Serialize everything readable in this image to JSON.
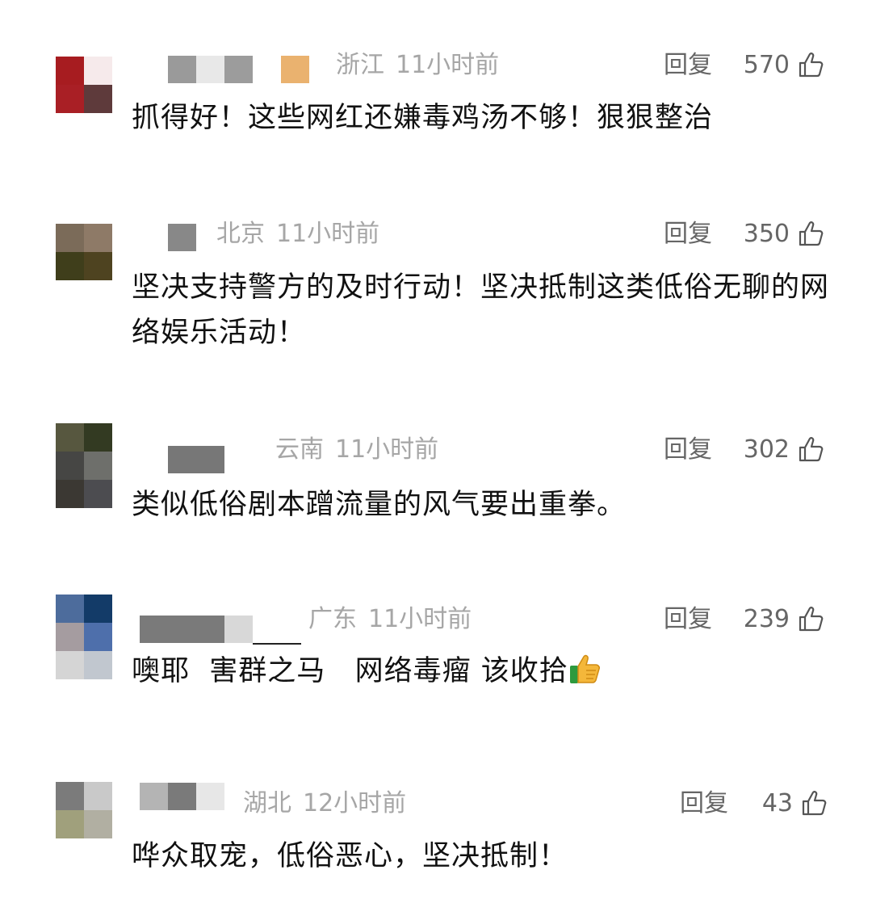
{
  "comments": [
    {
      "avatar_colors": [
        "#a71c20",
        "#f6eaeb",
        "#a91f25",
        "#5e3a3b"
      ],
      "name_blocks": [
        "#9a9a9a",
        "#e8e8e8",
        "#9c9c9c",
        "#eab26f"
      ],
      "location": "浙江",
      "time": "11小时前",
      "reply_label": "回复",
      "likes": "570",
      "text": "抓得好！这些网红还嫌毒鸡汤不够！狠狠整治"
    },
    {
      "avatar_colors": [
        "#7b6b59",
        "#8e7a67",
        "#3f3e1b",
        "#4e4320"
      ],
      "name_blocks": [
        "#888888"
      ],
      "location": "北京",
      "time": "11小时前",
      "reply_label": "回复",
      "likes": "350",
      "text": "坚决支持警方的及时行动！坚决抵制这类低俗无聊的网络娱乐活动！"
    },
    {
      "avatar_colors": [
        "#57573f",
        "#333a22",
        "#464644",
        "#6e6f6b",
        "#3b3833",
        "#4c4c50"
      ],
      "name_blocks": [
        "#777777"
      ],
      "location": "云南",
      "time": "11小时前",
      "reply_label": "回复",
      "likes": "302",
      "text": "类似低俗剧本蹭流量的风气要出重拳。"
    },
    {
      "avatar_colors": [
        "#4d6c9c",
        "#133b68",
        "#a59ca0",
        "#4e6fab",
        "#d5d5d5",
        "#c1c7cf"
      ],
      "name_blocks": [
        "#7a7a7a",
        "#d8d8d8"
      ],
      "location": "广东",
      "time": "11小时前",
      "reply_label": "回复",
      "likes": "239",
      "text": "噢耶  害群之马   网络毒瘤 该收拾"
    },
    {
      "avatar_colors": [
        "#7b7b7b",
        "#c9c9c9",
        "#a0a07c",
        "#b1afa2"
      ],
      "name_blocks": [
        "#b4b4b4",
        "#7a7a7a",
        "#e7e7e7"
      ],
      "location": "湖北",
      "time": "12小时前",
      "reply_label": "回复",
      "likes": "43",
      "text": "哗众取宠，低俗恶心，坚决抵制！"
    }
  ]
}
